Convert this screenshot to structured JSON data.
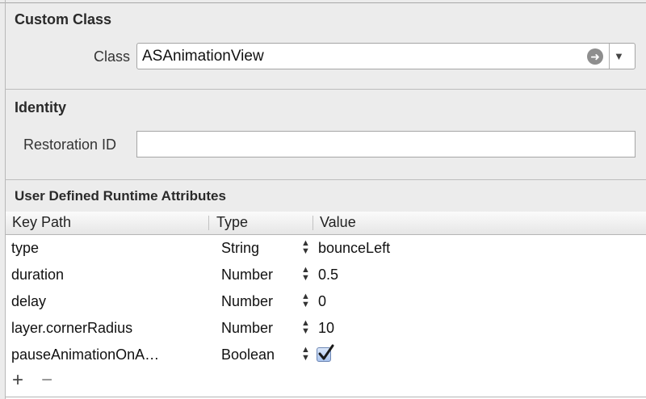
{
  "custom_class": {
    "title": "Custom Class",
    "class_label": "Class",
    "class_value": "ASAnimationView",
    "goto_icon": "arrow-right-circle-icon",
    "dropdown_icon": "triangle-down-icon"
  },
  "identity": {
    "title": "Identity",
    "restoration_label": "Restoration ID",
    "restoration_value": ""
  },
  "runtime_attributes": {
    "title": "User Defined Runtime Attributes",
    "columns": [
      "Key Path",
      "Type",
      "Value"
    ],
    "rows": [
      {
        "key_path": "type",
        "type": "String",
        "value": "bounceLeft"
      },
      {
        "key_path": "duration",
        "type": "Number",
        "value": "0.5"
      },
      {
        "key_path": "delay",
        "type": "Number",
        "value": "0"
      },
      {
        "key_path": "layer.cornerRadius",
        "type": "Number",
        "value": "10"
      },
      {
        "key_path": "pauseAnimationOnA…",
        "type": "Boolean",
        "value_checked": true
      }
    ],
    "add_label": "+",
    "remove_label": "−"
  }
}
